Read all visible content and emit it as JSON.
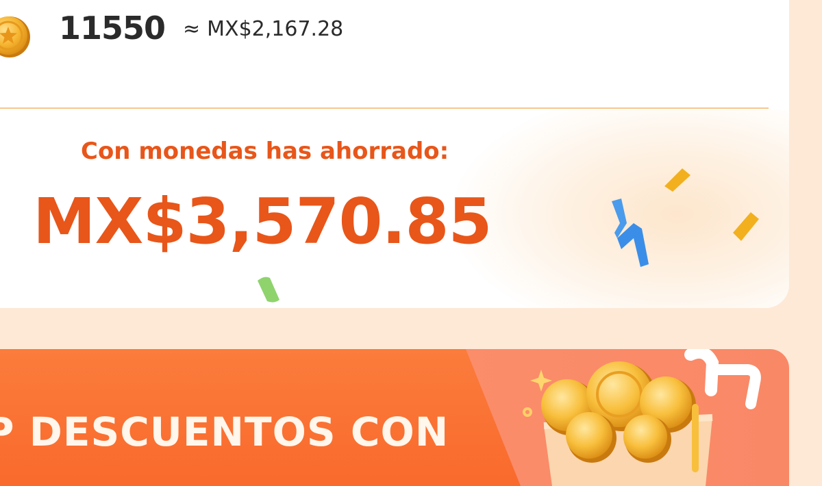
{
  "coins": {
    "count": "11550",
    "approx_sign": "≈",
    "approx_value": "MX$2,167.28",
    "icon": "gold-coin-icon"
  },
  "savings": {
    "label": "Con monedas has ahorrado:",
    "amount": "MX$3,570.85"
  },
  "banner": {
    "text": "P DESCUENTOS CON",
    "illustration": "coin-cart-illustration"
  },
  "colors": {
    "accent": "#e8561a",
    "divider": "#f6c68f",
    "page_bg": "#fde9d6",
    "banner_orange": "#f96a2c",
    "confetti_yellow": "#f2b01e",
    "confetti_blue": "#3b8ee8",
    "confetti_green": "#8fd36d"
  }
}
